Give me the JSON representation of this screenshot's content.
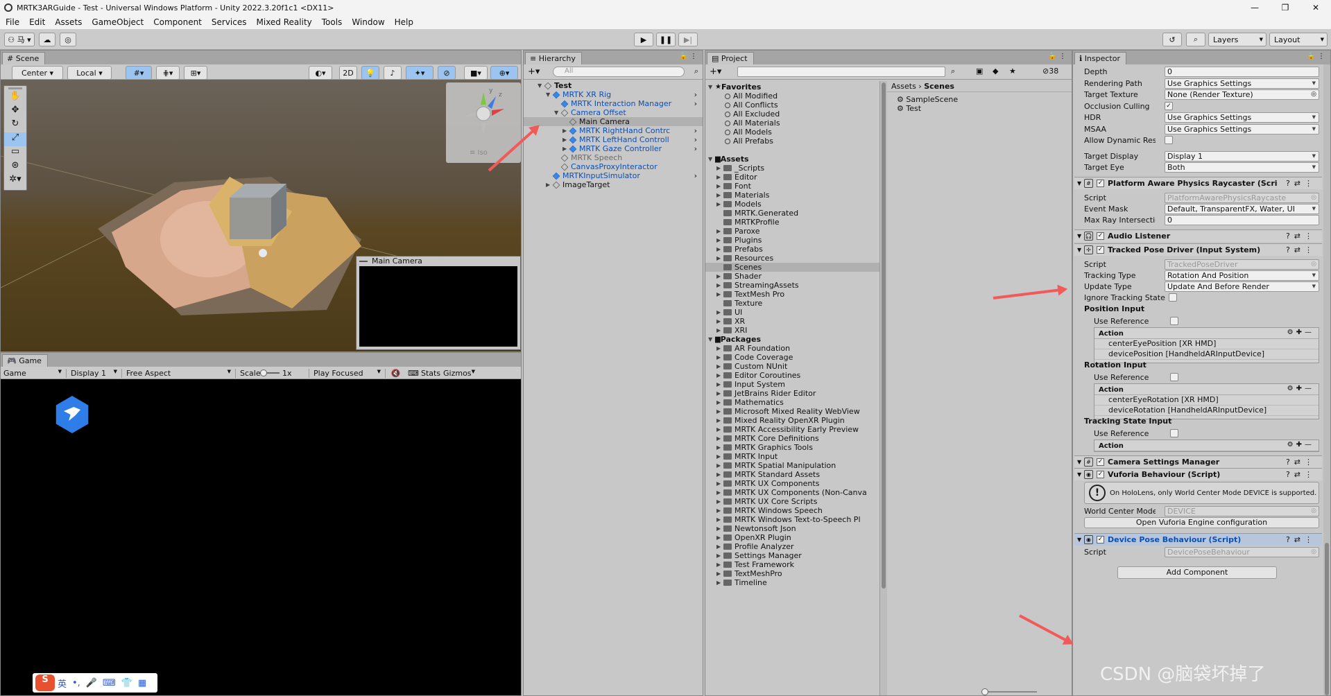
{
  "window": {
    "title": "MRTK3ARGuide - Test - Universal Windows Platform - Unity 2022.3.20f1c1 <DX11>",
    "min": "—",
    "max": "❐",
    "close": "✕"
  },
  "menu": [
    "File",
    "Edit",
    "Assets",
    "GameObject",
    "Component",
    "Services",
    "Mixed Reality",
    "Tools",
    "Window",
    "Help"
  ],
  "toolbar": {
    "account": "⚇ 马 ▾",
    "layers": "Layers",
    "layout": "Layout"
  },
  "scene": {
    "tab": "Scene",
    "pivot": "Center",
    "space": "Local",
    "mode2d": "2D",
    "iso": "≡ Iso",
    "overlay_title": "Main Camera"
  },
  "game": {
    "tab": "Game",
    "display_mode": "Game",
    "display": "Display 1",
    "aspect": "Free Aspect",
    "scale_label": "Scale",
    "scale_value": "1x",
    "play_mode": "Play Focused",
    "stats": "Stats",
    "gizmos": "Gizmos",
    "ime_lang": "英"
  },
  "hierarchy": {
    "tab": "Hierarchy",
    "search_placeholder": "All",
    "items": [
      {
        "label": "Test",
        "indent": 0,
        "tri": "▼",
        "icon": "scene",
        "style": "bold"
      },
      {
        "label": "MRTK XR Rig",
        "indent": 1,
        "tri": "▼",
        "icon": "prefab",
        "style": "blue",
        "more": "›"
      },
      {
        "label": "MRTK Interaction Manager",
        "indent": 2,
        "tri": "",
        "icon": "prefab",
        "style": "blue",
        "more": "›"
      },
      {
        "label": "Camera Offset",
        "indent": 2,
        "tri": "▼",
        "icon": "object",
        "style": "blue"
      },
      {
        "label": "Main Camera",
        "indent": 3,
        "tri": "",
        "icon": "object",
        "style": "selected"
      },
      {
        "label": "MRTK RightHand Contrc",
        "indent": 3,
        "tri": "▶",
        "icon": "prefab",
        "style": "blue",
        "more": "›"
      },
      {
        "label": "MRTK LeftHand Controll",
        "indent": 3,
        "tri": "▶",
        "icon": "prefab",
        "style": "blue",
        "more": "›"
      },
      {
        "label": "MRTK Gaze Controller",
        "indent": 3,
        "tri": "▶",
        "icon": "prefab",
        "style": "blue",
        "more": "›"
      },
      {
        "label": "MRTK Speech",
        "indent": 2,
        "tri": "",
        "icon": "object",
        "style": "gray"
      },
      {
        "label": "CanvasProxyInteractor",
        "indent": 2,
        "tri": "",
        "icon": "object",
        "style": "blue"
      },
      {
        "label": "MRTKInputSimulator",
        "indent": 1,
        "tri": "",
        "icon": "prefab",
        "style": "blue",
        "more": "›"
      },
      {
        "label": "ImageTarget",
        "indent": 1,
        "tri": "▶",
        "icon": "object",
        "style": "normal"
      }
    ]
  },
  "project": {
    "tab": "Project",
    "count": "38",
    "breadcrumb": [
      "Assets",
      "Scenes"
    ],
    "favorites_label": "Favorites",
    "favorites": [
      "All Modified",
      "All Conflicts",
      "All Excluded",
      "All Materials",
      "All Models",
      "All Prefabs"
    ],
    "assets_label": "Assets",
    "assets": [
      "_Scripts",
      "Editor",
      "Font",
      "Materials",
      "Models",
      "MRTK.Generated",
      "MRTKProfile",
      "Paroxe",
      "Plugins",
      "Prefabs",
      "Resources",
      "Scenes",
      "Shader",
      "StreamingAssets",
      "TextMesh Pro",
      "Texture",
      "UI",
      "XR",
      "XRI"
    ],
    "packages_label": "Packages",
    "packages": [
      "AR Foundation",
      "Code Coverage",
      "Custom NUnit",
      "Editor Coroutines",
      "Input System",
      "JetBrains Rider Editor",
      "Mathematics",
      "Microsoft Mixed Reality WebView",
      "Mixed Reality OpenXR Plugin",
      "MRTK Accessibility Early Preview",
      "MRTK Core Definitions",
      "MRTK Graphics Tools",
      "MRTK Input",
      "MRTK Spatial Manipulation",
      "MRTK Standard Assets",
      "MRTK UX Components",
      "MRTK UX Components (Non-Canva",
      "MRTK UX Core Scripts",
      "MRTK Windows Speech",
      "MRTK Windows Text-to-Speech Pl",
      "Newtonsoft Json",
      "OpenXR Plugin",
      "Profile Analyzer",
      "Settings Manager",
      "Test Framework",
      "TextMeshPro",
      "Timeline"
    ],
    "files": [
      "SampleScene",
      "Test"
    ]
  },
  "inspector": {
    "tab": "Inspector",
    "camera": [
      {
        "label": "Depth",
        "value": "0",
        "kind": "text"
      },
      {
        "label": "Rendering Path",
        "value": "Use Graphics Settings",
        "kind": "dd"
      },
      {
        "label": "Target Texture",
        "value": "None (Render Texture)",
        "kind": "obj"
      },
      {
        "label": "Occlusion Culling",
        "value": "✓",
        "kind": "chk"
      },
      {
        "label": "HDR",
        "value": "Use Graphics Settings",
        "kind": "dd"
      },
      {
        "label": "MSAA",
        "value": "Use Graphics Settings",
        "kind": "dd"
      },
      {
        "label": "Allow Dynamic Resolu",
        "value": "",
        "kind": "chk"
      },
      {
        "label": "Target Display",
        "value": "Display 1",
        "kind": "dd"
      },
      {
        "label": "Target Eye",
        "value": "Both",
        "kind": "dd"
      }
    ],
    "raycaster": {
      "title": "Platform Aware Physics Raycaster (Scri",
      "script_label": "Script",
      "script": "PlatformAwarePhysicsRaycaste",
      "event_mask_label": "Event Mask",
      "event_mask": "Default, TransparentFX, Water, UI",
      "max_ray_label": "Max Ray Intersections",
      "max_ray": "0"
    },
    "audio": {
      "title": "Audio Listener"
    },
    "tpd": {
      "title": "Tracked Pose Driver (Input System)",
      "script_label": "Script",
      "script": "TrackedPoseDriver",
      "tracking_type_label": "Tracking Type",
      "tracking_type": "Rotation And Position",
      "update_type_label": "Update Type",
      "update_type": "Update And Before Render",
      "ignore_label": "Ignore Tracking State",
      "pos_label": "Position Input",
      "use_ref": "Use Reference",
      "action": "Action",
      "pos_bindings": [
        "centerEyePosition [XR HMD]",
        "devicePosition [HandheldARInputDevice]"
      ],
      "rot_label": "Rotation Input",
      "rot_bindings": [
        "centerEyeRotation [XR HMD]",
        "deviceRotation [HandheldARInputDevice]"
      ],
      "state_label": "Tracking State Input"
    },
    "csm": {
      "title": "Camera Settings Manager"
    },
    "vuforia": {
      "title": "Vuforia Behaviour (Script)",
      "warning": "On HoloLens, only World Center Mode DEVICE is supported.",
      "wcm_label": "World Center Mode",
      "wcm": "DEVICE",
      "open_btn": "Open Vuforia Engine configuration"
    },
    "dpb": {
      "title": "Device Pose Behaviour (Script)",
      "script_label": "Script",
      "script": "DevicePoseBehaviour"
    },
    "add_component": "Add Component"
  },
  "watermark": "CSDN @脑袋坏掉了"
}
